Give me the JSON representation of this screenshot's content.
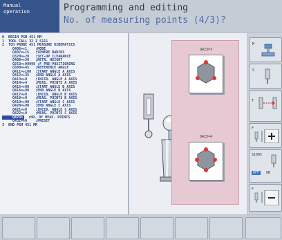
{
  "header": {
    "mode_line1": "Manual",
    "mode_line2": "operation",
    "title": "Programming and editing",
    "prompt": "No. of measuring points (4/3)?"
  },
  "program": {
    "lines": [
      "0  BEGIN PGM 451 MM",
      "1  TOOL CALL 32 Z S111",
      "2  TCH PROBE 451 MEASURE KINEMATICS",
      "     Q406=+1    ;MODE",
      "     Q407=+15   ;SPHERE RADIUS",
      "     Q320=+20   ;SET-UP CLEARANCE",
      "     Q408=+50   ;RETR. HEIGHT",
      "     Q253=+99999 ;F PRE-POSITIONING",
      "     Q380=+45   ;REFERENCE ANGLE",
      "     Q411=+100  ;START ANGLE A AXIS",
      "     Q412=+35   ;END ANGLE A AXIS",
      "     Q413=+0    ;INCID. ANGLE A AXIS",
      "     Q414=+4    ;MEAS. POINTS A AXIS",
      "     Q415=+80   ;START ANGLE B AXIS",
      "     Q416=+90   ;END ANGLE B AXIS",
      "     Q417=+0    ;INCID. ANGLE B AXIS",
      "     Q418=+0    ;MEAS. POINTS B AXIS",
      "     Q419=+90   ;START ANGLE C AXIS",
      "     Q420=+90   ;END ANGLE C AXIS",
      "     Q421=+0    ;INCID. ANGLE C AXIS",
      "     Q422=+0    ;MEAS. POINTS C AXIS",
      "     Q423=",
      "     Q431=+0    ;PRESET",
      "3  END PGM 451 MM"
    ],
    "selected_index": 21,
    "selected_comment": ";NO. OF MEAS. POINTS"
  },
  "graphic": {
    "card1_label": "Q423=3",
    "card2_label": "Q423=4"
  },
  "right_keys": {
    "k1": "M",
    "k2": "S",
    "k3": "T",
    "k4": "F",
    "k5a": "S100%",
    "k5b": "OFF",
    "k5c": "ON",
    "k6": "F"
  },
  "colors": {
    "accent": "#36548c",
    "selected_bg": "#2e4aa0",
    "help_bg": "#e7c9d3"
  }
}
